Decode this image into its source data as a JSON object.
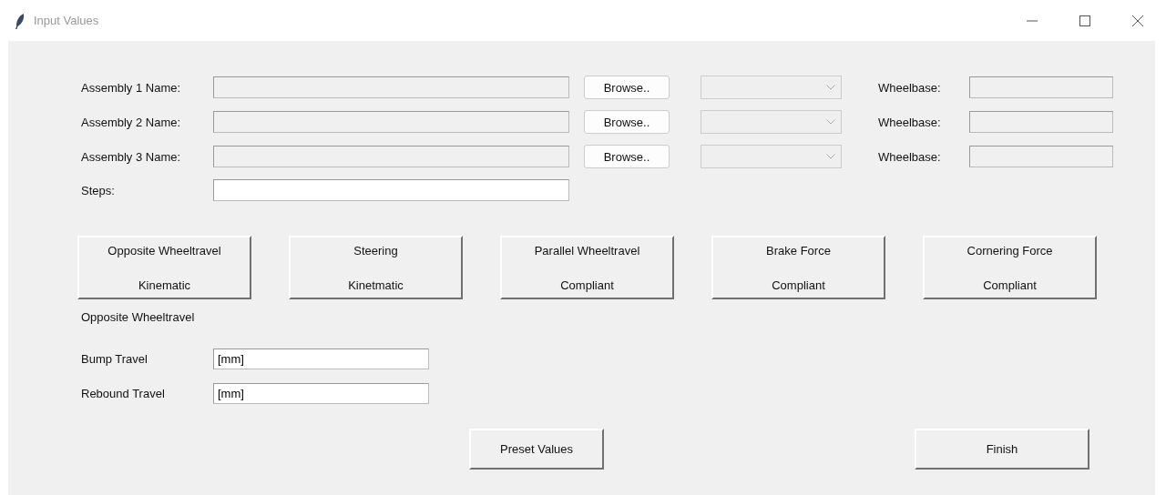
{
  "window": {
    "title": "Input Values"
  },
  "assemblies": [
    {
      "label": "Assembly 1 Name:",
      "name_disabled": true,
      "browse": "Browse..",
      "combo_disabled": true,
      "wheelbase_label": "Wheelbase:",
      "wheelbase_disabled": true
    },
    {
      "label": "Assembly 2 Name:",
      "name_disabled": true,
      "browse": "Browse..",
      "combo_disabled": true,
      "wheelbase_label": "Wheelbase:",
      "wheelbase_disabled": true
    },
    {
      "label": "Assembly 3 Name:",
      "name_disabled": true,
      "browse": "Browse..",
      "combo_disabled": true,
      "wheelbase_label": "Wheelbase:",
      "wheelbase_disabled": true
    }
  ],
  "steps": {
    "label": "Steps:",
    "disabled": false
  },
  "modes": [
    {
      "lines": [
        "Opposite Wheeltravel",
        "Kinematic"
      ]
    },
    {
      "lines": [
        "Steering",
        "Kinetmatic"
      ]
    },
    {
      "lines": [
        "Parallel Wheeltravel",
        "Compliant"
      ]
    },
    {
      "lines": [
        "Brake Force",
        "Compliant"
      ]
    },
    {
      "lines": [
        "Cornering Force",
        "Compliant"
      ]
    }
  ],
  "section_label": "Opposite Wheeltravel",
  "params": [
    {
      "label": "Bump Travel",
      "value": "[mm]"
    },
    {
      "label": "Rebound Travel",
      "value": "[mm]"
    }
  ],
  "buttons": {
    "preset": "Preset Values",
    "finish": "Finish"
  }
}
